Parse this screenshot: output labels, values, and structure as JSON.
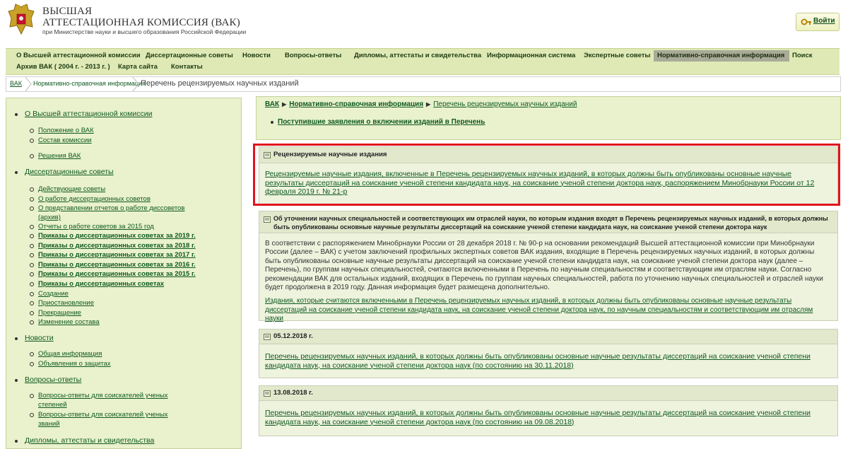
{
  "header": {
    "title_line1": "ВЫСШАЯ",
    "title_line2": "АТТЕСТАЦИОННАЯ КОМИССИЯ (ВАК)",
    "subtitle": "при Министерстве науки и высшего образования Российской Федерации",
    "login_label": "Войти",
    "emblem_icon": "russian-coat-of-arms-icon",
    "key_icon": "key-icon"
  },
  "nav": {
    "row1": [
      "О Высшей аттестационной комиссии",
      "Диссертационные советы",
      "Новости",
      "Вопросы-ответы",
      "Дипломы, аттестаты и свидетельства",
      "Информационная система",
      "Экспертные советы",
      "Нормативно-справочная информация",
      "Поиск"
    ],
    "row2": [
      "Архив ВАК ( 2004 г. - 2013 г. )",
      "Карта сайта",
      "Контакты"
    ],
    "active": "Нормативно-справочная информация"
  },
  "breadcrumb": {
    "root": "ВАК",
    "section": "Нормативно-справочная информация",
    "current": "Перечень рецензируемых научных изданий"
  },
  "sidebar": {
    "sections": [
      {
        "label": "О Высшей аттестационной комиссии",
        "items": [
          "Положение о ВАК",
          "Состав комиссии",
          "Решения ВАК"
        ]
      },
      {
        "label": "Диссертационные советы",
        "items": [
          "Действующие советы",
          "О работе диссертационных советов",
          "О представлении отчетов о работе диссоветов",
          "(архив)",
          "Отчеты о работе советов за 2015 год",
          "Приказы о диссертационных советах за 2019 г.",
          "Приказы о диссертационных советах за 2018 г.",
          "Приказы о диссертационных советах за 2017 г.",
          "Приказы о диссертационных советах за 2016 г.",
          "Приказы о диссертационных советах за 2015 г.",
          "Приказы о диссертационных советах",
          "Создание",
          "Приостановление",
          "Прекращение",
          "Изменение состава"
        ]
      },
      {
        "label": "Новости",
        "items": [
          "Общая информация",
          "Объявления о защитах"
        ]
      },
      {
        "label": "Вопросы-ответы",
        "items": [
          "Вопросы-ответы для соискателей ученых",
          "степеней",
          "Вопросы-ответы для соискателей ученых",
          "званий"
        ]
      },
      {
        "label": "Дипломы, аттестаты и свидетельства",
        "items": []
      }
    ]
  },
  "main": {
    "bc_root": "ВАК",
    "bc_section": "Нормативно-справочная информация",
    "bc_current": "Перечень рецензируемых научных изданий",
    "claims_link": "Поступившие заявления о включении изданий в Перечень",
    "boxes": [
      {
        "title": "Рецензируемые научные издания",
        "link": "Рецензируемые научные издания, включенные в Перечень рецензируемых научных изданий, в которых должны быть опубликованы основные научные результаты диссертаций на соискание ученой степени кандидата наук, на соискание ученой степени доктора наук, распоряжением Минобрнауки России от 12 февраля 2019 г. № 21-р"
      },
      {
        "title": "Об уточнении научных специальностей и соответствующих им отраслей науки, по которым издания входят в Перечень рецензируемых научных изданий, в которых должны быть опубликованы основные научные результаты диссертаций на соискание ученой степени кандидата наук, на соискание ученой степени доктора наук",
        "text": "В соответствии с распоряжением Минобрнауки России от 28 декабря 2018 г. № 90-р на основании рекомендаций Высшей аттестационной комиссии при Минобрнауки России (далее – ВАК) с учетом заключений профильных экспертных советов ВАК издания, входящие в Перечень рецензируемых научных изданий, в которых должны быть опубликованы основные научные результаты диссертаций на соискание ученой степени кандидата наук, на соискание ученой степени доктора наук (далее – Перечень), по группам научных специальностей, считаются включенными в Перечень по научным специальностям и соответствующим им отраслям науки. Согласно рекомендации ВАК для остальных изданий, входящих в Перечень по группам научных специальностей, работа по уточнению научных специальностей и отраслей науки будет продолжена в 2019 году. Данная информация будет размещена дополнительно.",
        "link": "Издания, которые считаются включенными в Перечень рецензируемых научных изданий, в которых должны быть опубликованы основные научные результаты диссертаций на соискание ученой степени кандидата наук, на соискание ученой степени доктора наук, по научным специальностям и соответствующим им отраслям науки"
      },
      {
        "title": "05.12.2018 г.",
        "link": "Перечень рецензируемых научных изданий, в которых должны быть опубликованы основные научные результаты диссертаций на соискание ученой степени кандидата наук, на соискание ученой степени доктора наук (по состоянию на 30.11.2018)"
      },
      {
        "title": "13.08.2018 г.",
        "link": "Перечень рецензируемых научных изданий, в которых должны быть опубликованы основные научные результаты диссертаций на соискание ученой степени кандидата наук, на соискание ученой степени доктора наук (по состоянию на 09.08.2018)"
      }
    ]
  },
  "colors": {
    "accent_green": "#0f5a1f",
    "panel_bg": "#e9f1cd",
    "nav_bg": "#dfe9b6",
    "highlight_red": "#e0141d"
  }
}
